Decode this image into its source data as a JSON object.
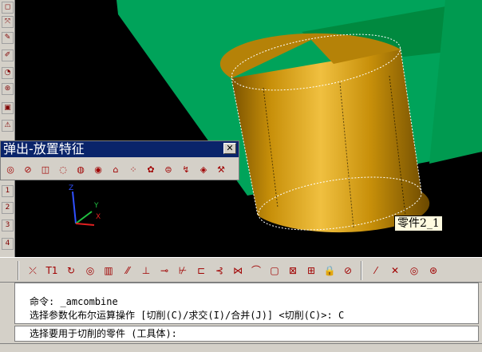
{
  "popup_toolbar": {
    "title": "弹出-放置特征",
    "close": "✕"
  },
  "viewport": {
    "part_label": "零件2_1",
    "axes": {
      "x": "X",
      "y": "Y",
      "z": "Z"
    },
    "colors": {
      "background": "#000000",
      "box": "#00a35a",
      "cylinder": "#c8900a"
    }
  },
  "command": {
    "line1": "命令: _amcombine",
    "line2": "选择参数化布尔运算操作 [切削(C)/求交(I)/合并(J)] <切削(C)>: C",
    "prompt": "选择要用于切削的零件 (工具体):"
  },
  "left_toolbar": {
    "items": [
      {
        "icon": "tool-icon"
      },
      {
        "icon": "tool-icon"
      },
      {
        "icon": "tool-icon"
      },
      {
        "icon": "tool-icon"
      },
      {
        "icon": "tool-icon"
      },
      {
        "icon": "tool-icon"
      },
      {
        "icon": "tool-icon"
      },
      {
        "icon": "tool-icon"
      },
      {
        "icon": "warning-icon"
      },
      {
        "icon": "tool-icon"
      },
      {
        "icon": "tool-icon"
      },
      {
        "icon": "tool-icon"
      },
      {
        "icon": "tool-icon"
      }
    ],
    "numbers": [
      "1",
      "2",
      "3",
      "4"
    ]
  },
  "popup_tools": [
    "◎",
    "⊘",
    "◫",
    "◌",
    "◍",
    "◉",
    "⌂",
    "⁘",
    "✿",
    "⊜",
    "↯",
    "◈",
    "⚒"
  ],
  "mid_tools": [
    "⤫",
    "T1",
    "↻",
    "◎",
    "▥",
    "⁄⁄",
    "⊥",
    "⊸",
    "⊬",
    "⊏",
    "⊰",
    "⋈",
    "⌒",
    "▢",
    "⊠",
    "⊞",
    "🔒",
    "⊘",
    "⁄",
    "✕",
    "◎",
    "⊛"
  ],
  "mid_text": {
    "t1": "T1"
  }
}
